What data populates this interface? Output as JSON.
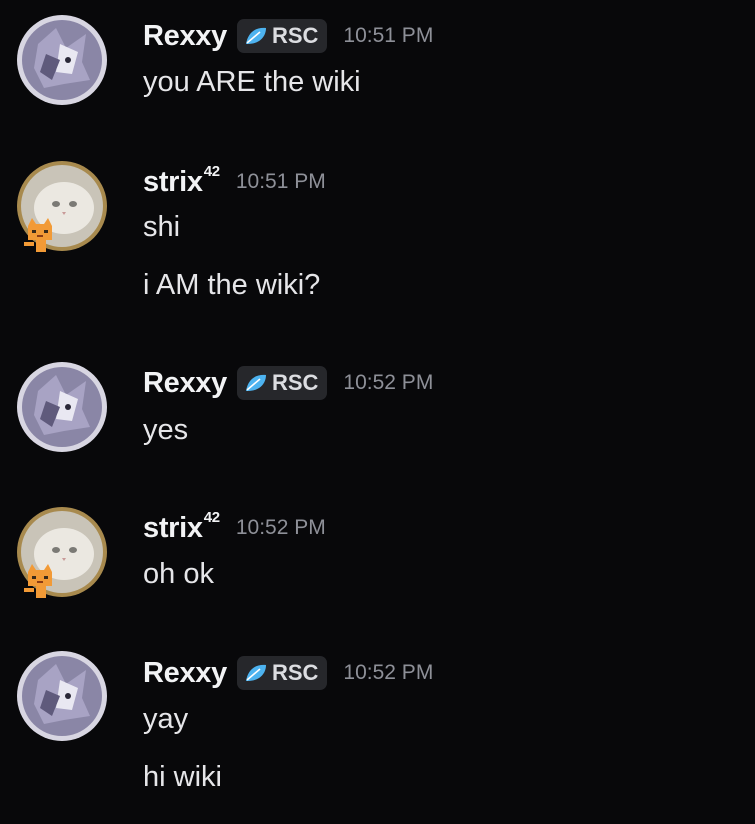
{
  "messages": [
    {
      "author": "Rexxy",
      "author_sup": "",
      "tag": "RSC",
      "time": "10:51 PM",
      "lines": [
        "you ARE the wiki"
      ]
    },
    {
      "author": "strix",
      "author_sup": "42",
      "tag": "",
      "time": "10:51 PM",
      "lines": [
        "shi",
        "i AM the wiki?"
      ]
    },
    {
      "author": "Rexxy",
      "author_sup": "",
      "tag": "RSC",
      "time": "10:52 PM",
      "lines": [
        "yes"
      ]
    },
    {
      "author": "strix",
      "author_sup": "42",
      "tag": "",
      "time": "10:52 PM",
      "lines": [
        "oh ok"
      ]
    },
    {
      "author": "Rexxy",
      "author_sup": "",
      "tag": "RSC",
      "time": "10:52 PM",
      "lines": [
        "yay",
        "hi wiki"
      ]
    }
  ],
  "colors": {
    "background": "#08080a",
    "tag_background": "#26272b",
    "tag_icon": "#4db3f0",
    "timestamp": "#8e9098"
  },
  "icons": {
    "rexxy_avatar": "purple-character-avatar",
    "strix_avatar": "white-cat-avatar-with-orange-cat-decoration",
    "tag_icon": "leaf-icon"
  }
}
